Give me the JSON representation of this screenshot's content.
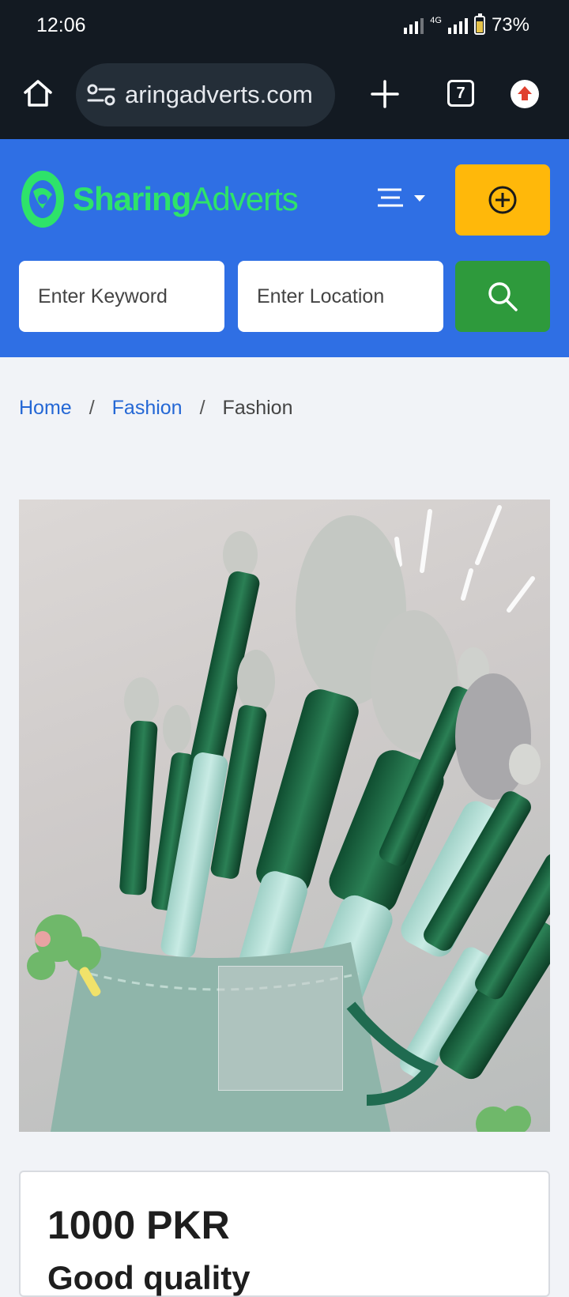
{
  "status_bar": {
    "time": "12:06",
    "network": "4G",
    "battery_percent": "73%",
    "battery_level": 0.73
  },
  "browser": {
    "url": "aringadverts.com",
    "tab_count": "7",
    "icons": [
      "home-icon",
      "site-settings-icon",
      "new-tab-icon",
      "tabs-icon",
      "update-icon"
    ]
  },
  "header": {
    "logo_bold": "Sharing",
    "logo_light": "Adverts",
    "brand_color": "#2ee36a",
    "header_color": "#2f6fe4",
    "post_button_color": "#ffb80a",
    "search_button_color": "#2e9a3c"
  },
  "search": {
    "keyword_placeholder": "Enter Keyword",
    "location_placeholder": "Enter Location"
  },
  "breadcrumb": {
    "items": [
      "Home",
      "Fashion",
      "Fashion"
    ],
    "separator": "/"
  },
  "product": {
    "image_alt": "makeup-brush-set",
    "price": "1000 PKR",
    "title": "Good quality"
  }
}
